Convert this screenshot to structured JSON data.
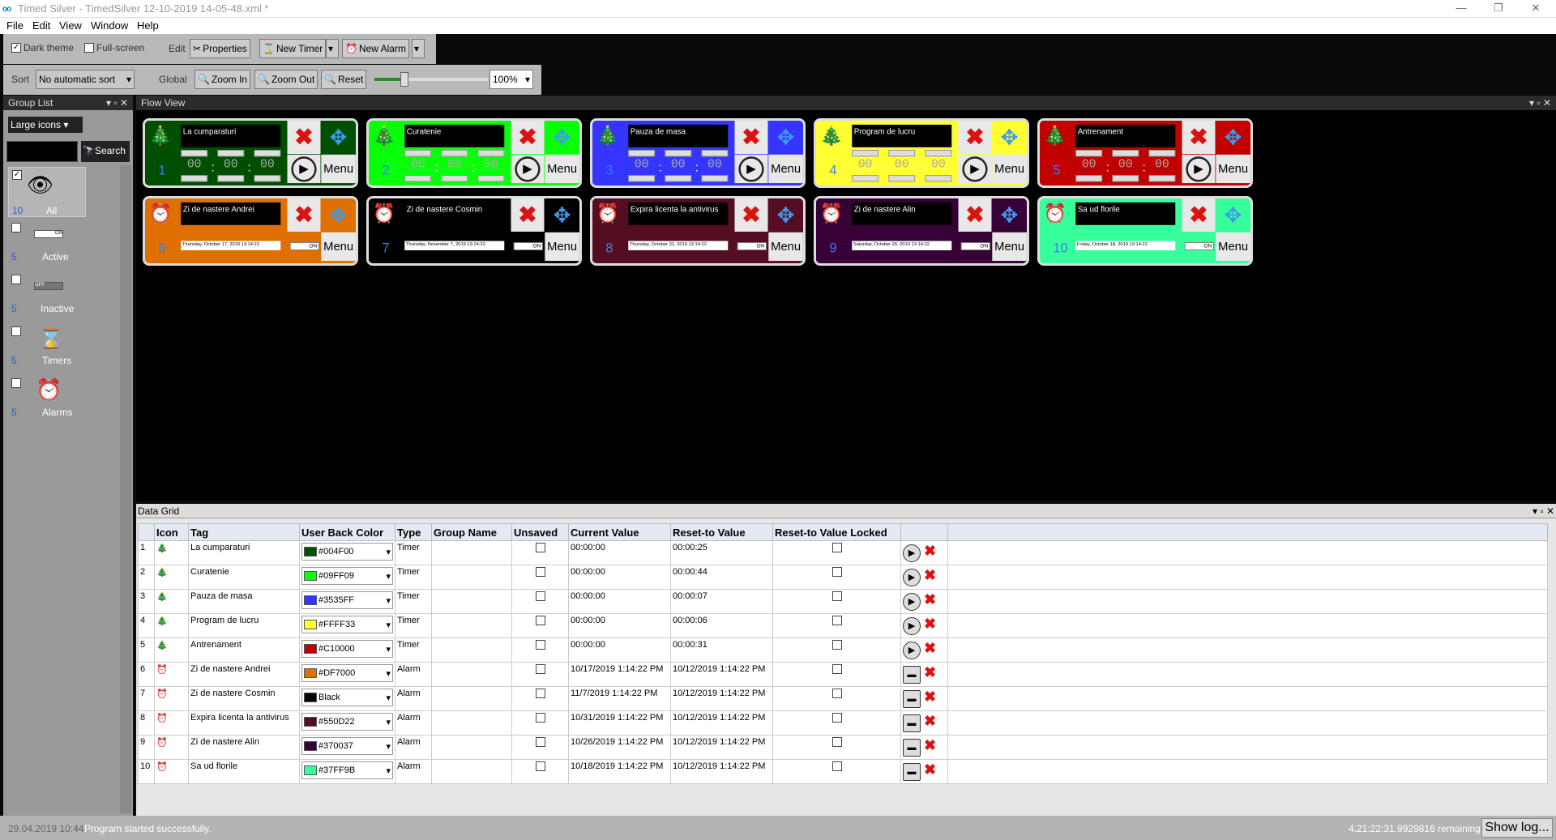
{
  "window": {
    "title": "Timed Silver - TimedSilver 12-10-2019 14-05-48.xml *",
    "logo": "oo",
    "minimize": "—",
    "restore": "❐",
    "close": "✕"
  },
  "menu": [
    "File",
    "Edit",
    "View",
    "Window",
    "Help"
  ],
  "toolbar1": {
    "dark_theme": "Dark theme",
    "full_screen": "Full-screen",
    "edit": "Edit",
    "properties": "Properties",
    "new_timer": "New Timer",
    "new_alarm": "New Alarm"
  },
  "toolbar2": {
    "sort_label": "Sort",
    "sort_value": "No automatic sort",
    "global": "Global",
    "zoom_in": "Zoom In",
    "zoom_out": "Zoom Out",
    "reset": "Reset",
    "zoom_level": "100%"
  },
  "group_list": {
    "title": "Group List",
    "view_mode": "Large icons",
    "search_label": "Search",
    "search_value": "",
    "groups": [
      {
        "count": "10",
        "name": "All"
      },
      {
        "count": "5",
        "name": "Active"
      },
      {
        "count": "5",
        "name": "Inactive"
      },
      {
        "count": "5",
        "name": "Timers"
      },
      {
        "count": "5",
        "name": "Alarms"
      }
    ]
  },
  "flow_view": {
    "title": "Flow View",
    "menu_label": "Menu",
    "toggle_label": "ON",
    "cards": [
      {
        "num": "1",
        "name": "La cumparaturi",
        "type": "timer",
        "color": "#004F00",
        "h": "00",
        "m": "00",
        "s": "00"
      },
      {
        "num": "2",
        "name": "Curatenie",
        "type": "timer",
        "color": "#09FF09",
        "h": "00",
        "m": "00",
        "s": "00"
      },
      {
        "num": "3",
        "name": "Pauza de masa",
        "type": "timer",
        "color": "#3535FF",
        "h": "00",
        "m": "00",
        "s": "00"
      },
      {
        "num": "4",
        "name": "Program de lucru",
        "type": "timer",
        "color": "#FFFF33",
        "h": "00",
        "m": "00",
        "s": "00"
      },
      {
        "num": "5",
        "name": "Antrenament",
        "type": "timer",
        "color": "#C10000",
        "h": "00",
        "m": "00",
        "s": "00"
      },
      {
        "num": "6",
        "name": "Zi de nastere Andrei",
        "type": "alarm",
        "color": "#DF7000",
        "date": "Thursday, October 17, 2019 13:14:22"
      },
      {
        "num": "7",
        "name": "Zi de nastere Cosmin",
        "type": "alarm",
        "color": "#000000",
        "date": "Thursday, November 7, 2019 13:14:22"
      },
      {
        "num": "8",
        "name": "Expira licenta la antivirus",
        "type": "alarm",
        "color": "#550D22",
        "date": "Thursday, October 31, 2019 13:14:22"
      },
      {
        "num": "9",
        "name": "Zi de nastere Alin",
        "type": "alarm",
        "color": "#370037",
        "date": "Saturday, October 26, 2019 13:14:22"
      },
      {
        "num": "10",
        "name": "Sa ud florile",
        "type": "alarm",
        "color": "#37FF9B",
        "date": "Friday, October 18, 2019 13:14:22"
      }
    ]
  },
  "data_grid": {
    "title": "Data Grid",
    "columns": [
      "Icon",
      "Tag",
      "User Back Color",
      "Type",
      "Group Name",
      "Unsaved",
      "Current Value",
      "Reset-to Value",
      "Reset-to Value Locked"
    ],
    "rows": [
      {
        "n": "1",
        "tag": "La cumparaturi",
        "color_label": "#004F00",
        "color": "#004F00",
        "type": "Timer",
        "current": "00:00:00",
        "reset": "00:00:25"
      },
      {
        "n": "2",
        "tag": "Curatenie",
        "color_label": "#09FF09",
        "color": "#09FF09",
        "type": "Timer",
        "current": "00:00:00",
        "reset": "00:00:44"
      },
      {
        "n": "3",
        "tag": "Pauza de masa",
        "color_label": "#3535FF",
        "color": "#3535FF",
        "type": "Timer",
        "current": "00:00:00",
        "reset": "00:00:07"
      },
      {
        "n": "4",
        "tag": "Program de lucru",
        "color_label": "#FFFF33",
        "color": "#FFFF33",
        "type": "Timer",
        "current": "00:00:00",
        "reset": "00:00:06"
      },
      {
        "n": "5",
        "tag": "Antrenament",
        "color_label": "#C10000",
        "color": "#C10000",
        "type": "Timer",
        "current": "00:00:00",
        "reset": "00:00:31"
      },
      {
        "n": "6",
        "tag": "Zi de nastere Andrei",
        "color_label": "#DF7000",
        "color": "#DF7000",
        "type": "Alarm",
        "current": "10/17/2019 1:14:22 PM",
        "reset": "10/12/2019 1:14:22 PM"
      },
      {
        "n": "7",
        "tag": "Zi de nastere Cosmin",
        "color_label": "Black",
        "color": "#000000",
        "type": "Alarm",
        "current": "11/7/2019 1:14:22 PM",
        "reset": "10/12/2019 1:14:22 PM"
      },
      {
        "n": "8",
        "tag": "Expira licenta la antivirus",
        "color_label": "#550D22",
        "color": "#550D22",
        "type": "Alarm",
        "current": "10/31/2019 1:14:22 PM",
        "reset": "10/12/2019 1:14:22 PM"
      },
      {
        "n": "9",
        "tag": "Zi de nastere Alin",
        "color_label": "#370037",
        "color": "#370037",
        "type": "Alarm",
        "current": "10/26/2019 1:14:22 PM",
        "reset": "10/12/2019 1:14:22 PM"
      },
      {
        "n": "10",
        "tag": "Sa ud florile",
        "color_label": "#37FF9B",
        "color": "#37FF9B",
        "type": "Alarm",
        "current": "10/18/2019 1:14:22 PM",
        "reset": "10/12/2019 1:14:22 PM"
      }
    ]
  },
  "status": {
    "timestamp": "29.04.2019 10:44",
    "message": "Program started successfully.",
    "remaining": "4.21:22:31.9929816 remaining",
    "show_log": "Show log..."
  }
}
